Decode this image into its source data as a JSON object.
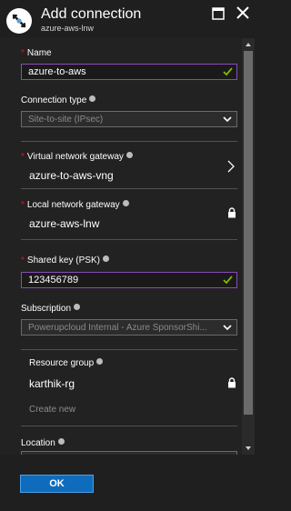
{
  "header": {
    "title": "Add connection",
    "subtitle": "azure-aws-lnw"
  },
  "form": {
    "name": {
      "label": "Name",
      "value": "azure-to-aws"
    },
    "connection_type": {
      "label": "Connection type",
      "value": "Site-to-site (IPsec)"
    },
    "vnet_gateway": {
      "label": "Virtual network gateway",
      "value": "azure-to-aws-vng"
    },
    "local_gateway": {
      "label": "Local network gateway",
      "value": "azure-aws-lnw"
    },
    "shared_key": {
      "label": "Shared key (PSK)",
      "value": "123456789"
    },
    "subscription": {
      "label": "Subscription",
      "value": "Powerupcloud Internal - Azure SponsorShi..."
    },
    "resource_group": {
      "label": "Resource group",
      "value": "karthik-rg",
      "create_new": "Create new"
    },
    "location": {
      "label": "Location"
    }
  },
  "footer": {
    "ok_label": "OK"
  },
  "colors": {
    "accent": "#0f6cbd",
    "required": "#e81123",
    "valid_check": "#7fba00",
    "focus_border": "#8a4bb8"
  },
  "icons": [
    "azure-connection-icon",
    "maximize-icon",
    "close-icon",
    "info-icon",
    "check-icon",
    "chevron-down-icon",
    "chevron-right-icon",
    "lock-icon"
  ]
}
